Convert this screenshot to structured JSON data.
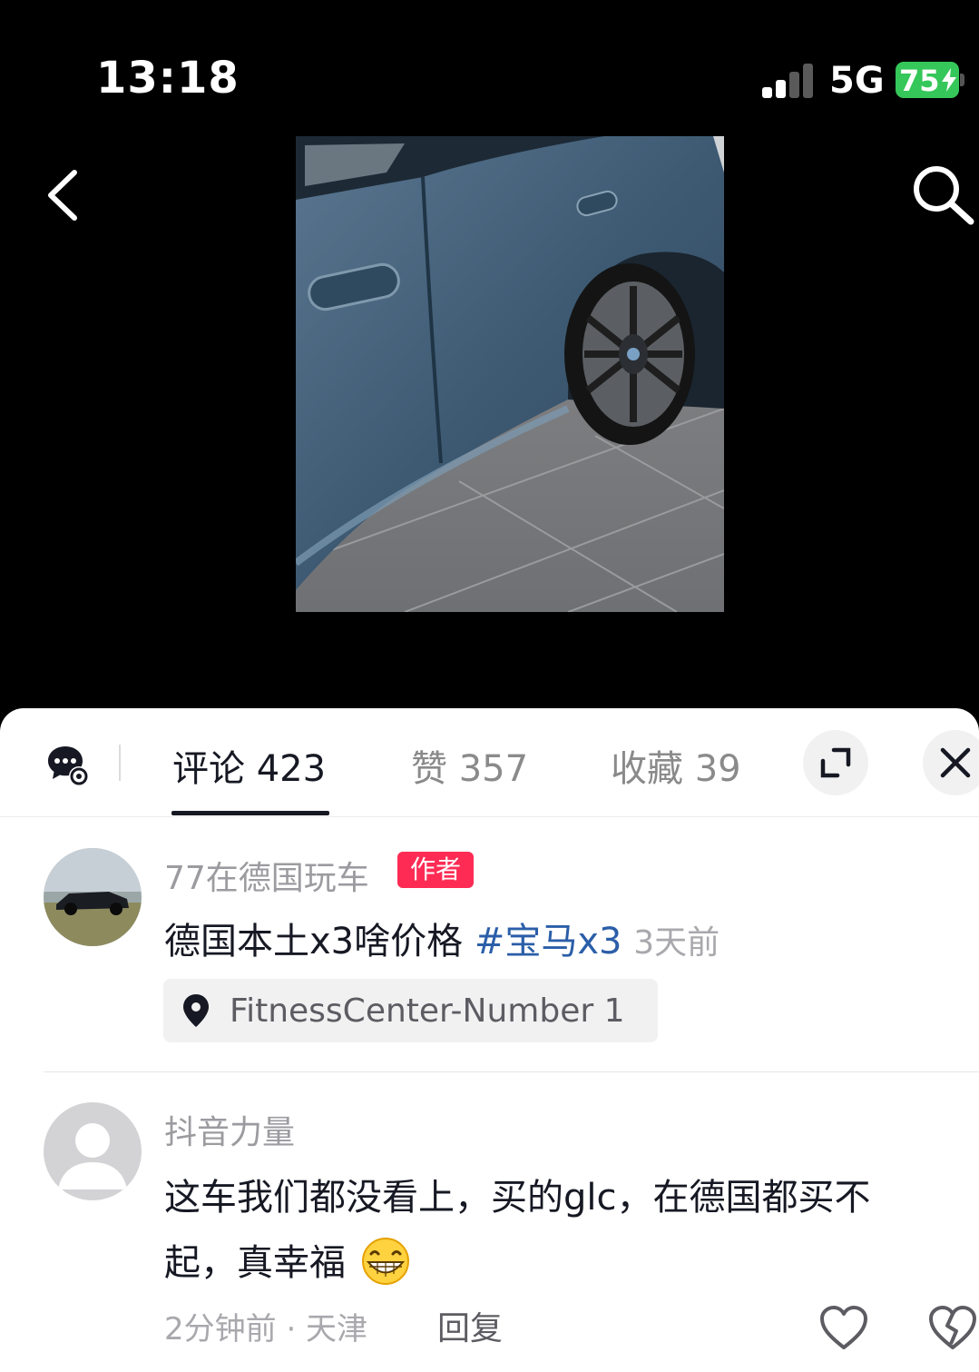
{
  "status_bar": {
    "time": "13:18",
    "network": "5G",
    "battery": "75"
  },
  "comments_panel": {
    "tabs": [
      {
        "label": "评论 423"
      },
      {
        "label": "赞 357"
      },
      {
        "label": "收藏 39"
      }
    ],
    "comments": [
      {
        "username": "77在德国玩车",
        "badge": "作者",
        "text": "德国本土x3啥价格",
        "hashtag": "#宝马x3",
        "time": "3天前",
        "location": "FitnessCenter-Number 1"
      },
      {
        "username": "抖音力量",
        "text_line1": "这车我们都没看上，买的glc，在德国都买不",
        "text_line2": "起，真幸福",
        "meta": "2分钟前 · 天津",
        "reply_label": "回复"
      }
    ]
  },
  "colors": {
    "accent": "#fe2c55",
    "hashtag": "#2b5ea8",
    "battery": "#35c759"
  }
}
